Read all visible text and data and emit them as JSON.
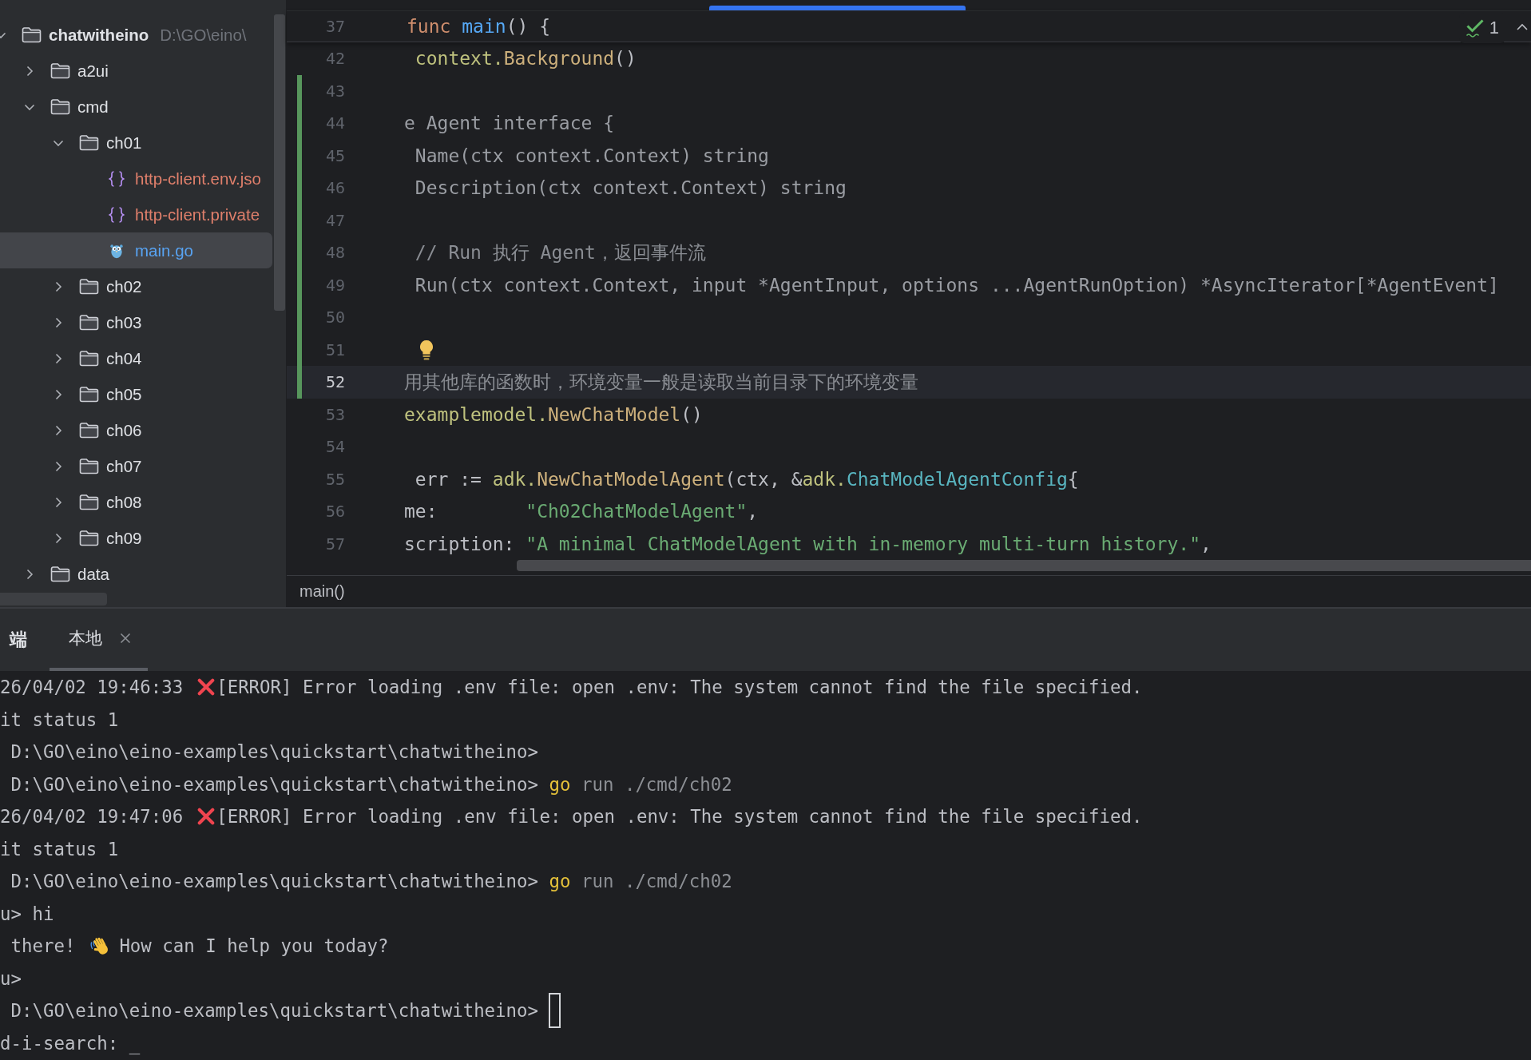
{
  "project_tree": {
    "root": {
      "name": "chatwitheino",
      "path": "D:\\GO\\eino\\",
      "kind": "folder",
      "expanded": true,
      "selected": false,
      "children": [
        {
          "name": "a2ui",
          "kind": "folder",
          "expanded": false,
          "selected": false
        },
        {
          "name": "cmd",
          "kind": "folder",
          "expanded": true,
          "selected": false,
          "children": [
            {
              "name": "ch01",
              "kind": "folder",
              "expanded": true,
              "selected": false,
              "children": [
                {
                  "name": "http-client.env.jso",
                  "kind": "json",
                  "color": "#df7f6b",
                  "selected": false
                },
                {
                  "name": "http-client.private",
                  "kind": "json",
                  "color": "#df7f6b",
                  "selected": false
                },
                {
                  "name": "main.go",
                  "kind": "go",
                  "color": "#58a3f2",
                  "selected": true
                }
              ]
            },
            {
              "name": "ch02",
              "kind": "folder",
              "expanded": false,
              "selected": false
            },
            {
              "name": "ch03",
              "kind": "folder",
              "expanded": false,
              "selected": false
            },
            {
              "name": "ch04",
              "kind": "folder",
              "expanded": false,
              "selected": false
            },
            {
              "name": "ch05",
              "kind": "folder",
              "expanded": false,
              "selected": false
            },
            {
              "name": "ch06",
              "kind": "folder",
              "expanded": false,
              "selected": false
            },
            {
              "name": "ch07",
              "kind": "folder",
              "expanded": false,
              "selected": false
            },
            {
              "name": "ch08",
              "kind": "folder",
              "expanded": false,
              "selected": false
            },
            {
              "name": "ch09",
              "kind": "folder",
              "expanded": false,
              "selected": false
            }
          ]
        },
        {
          "name": "data",
          "kind": "folder",
          "expanded": false,
          "selected": false
        }
      ]
    }
  },
  "editor": {
    "sticky_line": {
      "number": "37",
      "tokens": [
        {
          "kind": "keyword",
          "text": "func "
        },
        {
          "kind": "func_decl",
          "text": "main"
        },
        {
          "kind": "plain",
          "text": "() {"
        }
      ]
    },
    "inspection": {
      "count": "1"
    },
    "lines": [
      {
        "number": "42",
        "current": false,
        "changed": false,
        "bulb": false,
        "tokens": [
          {
            "kind": "package",
            "text": " context."
          },
          {
            "kind": "call",
            "text": "Background"
          },
          {
            "kind": "plain",
            "text": "()"
          }
        ]
      },
      {
        "number": "43",
        "current": false,
        "changed": true,
        "bulb": false
      },
      {
        "number": "44",
        "current": false,
        "changed": true,
        "bulb": false,
        "tokens": [
          {
            "kind": "dim",
            "text": "e Agent interface {"
          }
        ]
      },
      {
        "number": "45",
        "current": false,
        "changed": true,
        "bulb": false,
        "tokens": [
          {
            "kind": "dim",
            "text": " Name(ctx context.Context) string"
          }
        ]
      },
      {
        "number": "46",
        "current": false,
        "changed": true,
        "bulb": false,
        "tokens": [
          {
            "kind": "dim",
            "text": " Description(ctx context.Context) string"
          }
        ]
      },
      {
        "number": "47",
        "current": false,
        "changed": true,
        "bulb": false
      },
      {
        "number": "48",
        "current": false,
        "changed": true,
        "bulb": false,
        "tokens": [
          {
            "kind": "comment",
            "text": " // Run 执行 Agent，返回事件流"
          }
        ]
      },
      {
        "number": "49",
        "current": false,
        "changed": true,
        "bulb": false,
        "tokens": [
          {
            "kind": "dim",
            "text": " Run(ctx context.Context, input *AgentInput, options ...AgentRunOption) *AsyncIterator[*AgentEvent]"
          }
        ]
      },
      {
        "number": "50",
        "current": false,
        "changed": true,
        "bulb": false
      },
      {
        "number": "51",
        "current": false,
        "changed": true,
        "bulb": true
      },
      {
        "number": "52",
        "current": true,
        "changed": true,
        "bulb": false,
        "tokens": [
          {
            "kind": "comment",
            "text": "用其他库的函数时，环境变量一般是读取当前目录下的环境变量"
          }
        ]
      },
      {
        "number": "53",
        "current": false,
        "changed": false,
        "bulb": false,
        "tokens": [
          {
            "kind": "package",
            "text": "examplemodel."
          },
          {
            "kind": "call",
            "text": "NewChatModel"
          },
          {
            "kind": "plain",
            "text": "()"
          }
        ]
      },
      {
        "number": "54",
        "current": false,
        "changed": false,
        "bulb": false
      },
      {
        "number": "55",
        "current": false,
        "changed": false,
        "bulb": false,
        "tokens": [
          {
            "kind": "plain",
            "text": " err := "
          },
          {
            "kind": "package",
            "text": "adk."
          },
          {
            "kind": "call",
            "text": "NewChatModelAgent"
          },
          {
            "kind": "plain",
            "text": "(ctx, &"
          },
          {
            "kind": "package",
            "text": "adk."
          },
          {
            "kind": "type",
            "text": "ChatModelAgentConfig"
          },
          {
            "kind": "plain",
            "text": "{"
          }
        ]
      },
      {
        "number": "56",
        "current": false,
        "changed": false,
        "bulb": false,
        "tokens": [
          {
            "kind": "plain",
            "text": "me:        "
          },
          {
            "kind": "string",
            "text": "\"Ch02ChatModelAgent\""
          },
          {
            "kind": "plain",
            "text": ","
          }
        ]
      },
      {
        "number": "57",
        "current": false,
        "changed": false,
        "bulb": false,
        "tokens": [
          {
            "kind": "plain",
            "text": "scription: "
          },
          {
            "kind": "string",
            "text": "\"A minimal ChatModelAgent with in-memory multi-turn history.\""
          },
          {
            "kind": "plain",
            "text": ","
          }
        ]
      }
    ],
    "breadcrumb": [
      "main()"
    ]
  },
  "terminal": {
    "title": "端",
    "tabs": [
      {
        "label": "本地",
        "selected": true,
        "closable": true
      }
    ],
    "lines": [
      {
        "kind": "error",
        "time": "26/04/02 19:46:33",
        "message": "[ERROR] Error loading .env file: open .env: The system cannot find the file specified."
      },
      {
        "kind": "output",
        "text": "it status 1"
      },
      {
        "kind": "prompt",
        "prompt": " D:\\GO\\eino\\eino-examples\\quickstart\\chatwitheino>",
        "cursor": false
      },
      {
        "kind": "prompt",
        "prompt": " D:\\GO\\eino\\eino-examples\\quickstart\\chatwitheino>",
        "command": "go",
        "args": "run ./cmd/ch02",
        "cursor": false
      },
      {
        "kind": "error",
        "time": "26/04/02 19:47:06",
        "message": "[ERROR] Error loading .env file: open .env: The system cannot find the file specified."
      },
      {
        "kind": "output",
        "text": "it status 1"
      },
      {
        "kind": "prompt",
        "prompt": " D:\\GO\\eino\\eino-examples\\quickstart\\chatwitheino>",
        "command": "go",
        "args": "run ./cmd/ch02",
        "cursor": false
      },
      {
        "kind": "output",
        "text": "u> hi"
      },
      {
        "kind": "reply",
        "before": " there!",
        "after": "How can I help you today?"
      },
      {
        "kind": "output",
        "text": "u>"
      },
      {
        "kind": "prompt",
        "prompt": " D:\\GO\\eino\\eino-examples\\quickstart\\chatwitheino>",
        "cursor": true
      },
      {
        "kind": "output",
        "text": "d-i-search: _"
      }
    ]
  }
}
